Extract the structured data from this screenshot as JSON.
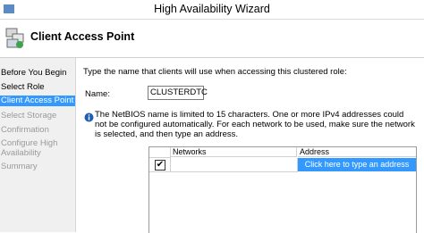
{
  "window": {
    "title": "High Availability Wizard"
  },
  "header": {
    "title": "Client Access Point",
    "icon": "cluster-wizard-icon"
  },
  "sidebar": {
    "items": [
      {
        "label": "Before You Begin",
        "state": "done"
      },
      {
        "label": "Select Role",
        "state": "done"
      },
      {
        "label": "Client Access Point",
        "state": "active"
      },
      {
        "label": "Select Storage",
        "state": "disabled"
      },
      {
        "label": "Confirmation",
        "state": "disabled"
      },
      {
        "label": "Configure High Availability",
        "state": "disabled"
      },
      {
        "label": "Summary",
        "state": "disabled"
      }
    ]
  },
  "main": {
    "prompt": "Type the name that clients will use when accessing this clustered role:",
    "name_label": "Name:",
    "name_value": "CLUSTERDTC",
    "info_text": "The NetBIOS name is limited to 15 characters.  One or more IPv4 addresses could not be configured automatically.  For each network to be used, make sure the network is selected, and then type an address.",
    "grid": {
      "columns": [
        "",
        "Networks",
        "Address"
      ],
      "rows": [
        {
          "checked": true,
          "check_mark": "✔",
          "network": "",
          "address": "Click here to type an address"
        }
      ]
    }
  },
  "colors": {
    "selection": "#3399ff",
    "sidebar_bg": "#f0f0f0"
  }
}
